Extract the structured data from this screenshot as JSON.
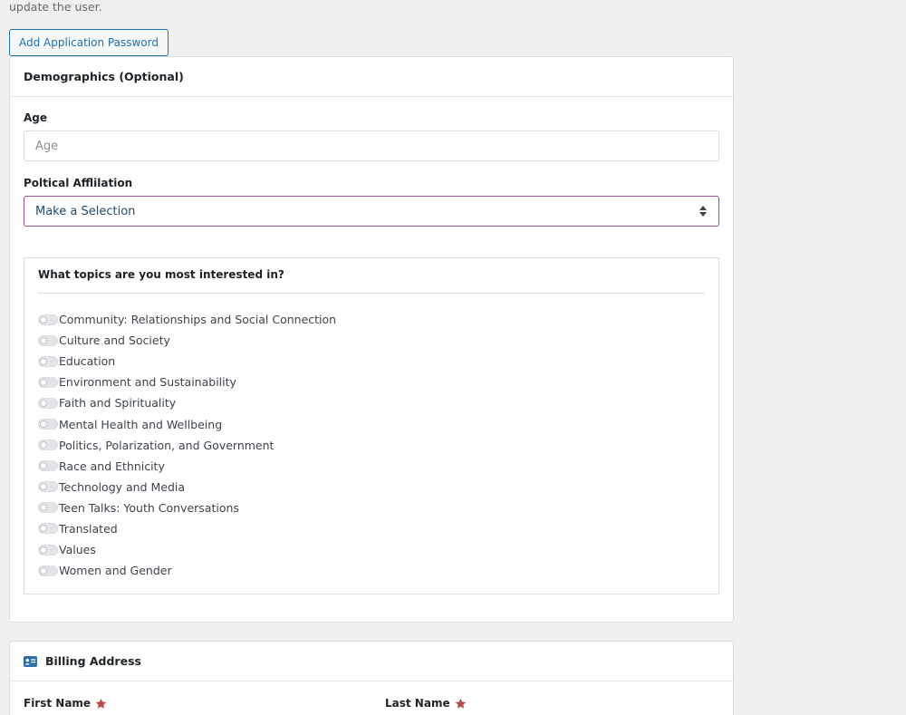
{
  "intro": {
    "text": "update the user."
  },
  "app_password_button": {
    "label": "Add Application Password"
  },
  "demographics": {
    "title": "Demographics (Optional)",
    "age": {
      "label": "Age",
      "placeholder": "Age",
      "value": ""
    },
    "political": {
      "label": "Poltical Afflilation",
      "selected": "Make a Selection"
    },
    "topics": {
      "title": "What topics are you most interested in?",
      "items": [
        {
          "label": "Community: Relationships and Social Connection",
          "checked": false
        },
        {
          "label": "Culture and Society",
          "checked": false
        },
        {
          "label": "Education",
          "checked": false
        },
        {
          "label": "Environment and Sustainability",
          "checked": false
        },
        {
          "label": "Faith and Spirituality",
          "checked": false
        },
        {
          "label": "Mental Health and Wellbeing",
          "checked": false
        },
        {
          "label": "Politics, Polarization, and Government",
          "checked": false
        },
        {
          "label": "Race and Ethnicity",
          "checked": false
        },
        {
          "label": "Technology and Media",
          "checked": false
        },
        {
          "label": "Teen Talks: Youth Conversations",
          "checked": false
        },
        {
          "label": "Translated",
          "checked": false
        },
        {
          "label": "Values",
          "checked": false
        },
        {
          "label": "Women and Gender",
          "checked": false
        }
      ]
    }
  },
  "billing": {
    "title": "Billing Address",
    "icon": "id-card-icon",
    "first_name_label": "First Name",
    "last_name_label": "Last Name"
  },
  "colors": {
    "accent_blue": "#2271b1",
    "select_border": "#9b4d96",
    "required_star": "#b94a48",
    "billing_icon": "#2f6fa7"
  }
}
